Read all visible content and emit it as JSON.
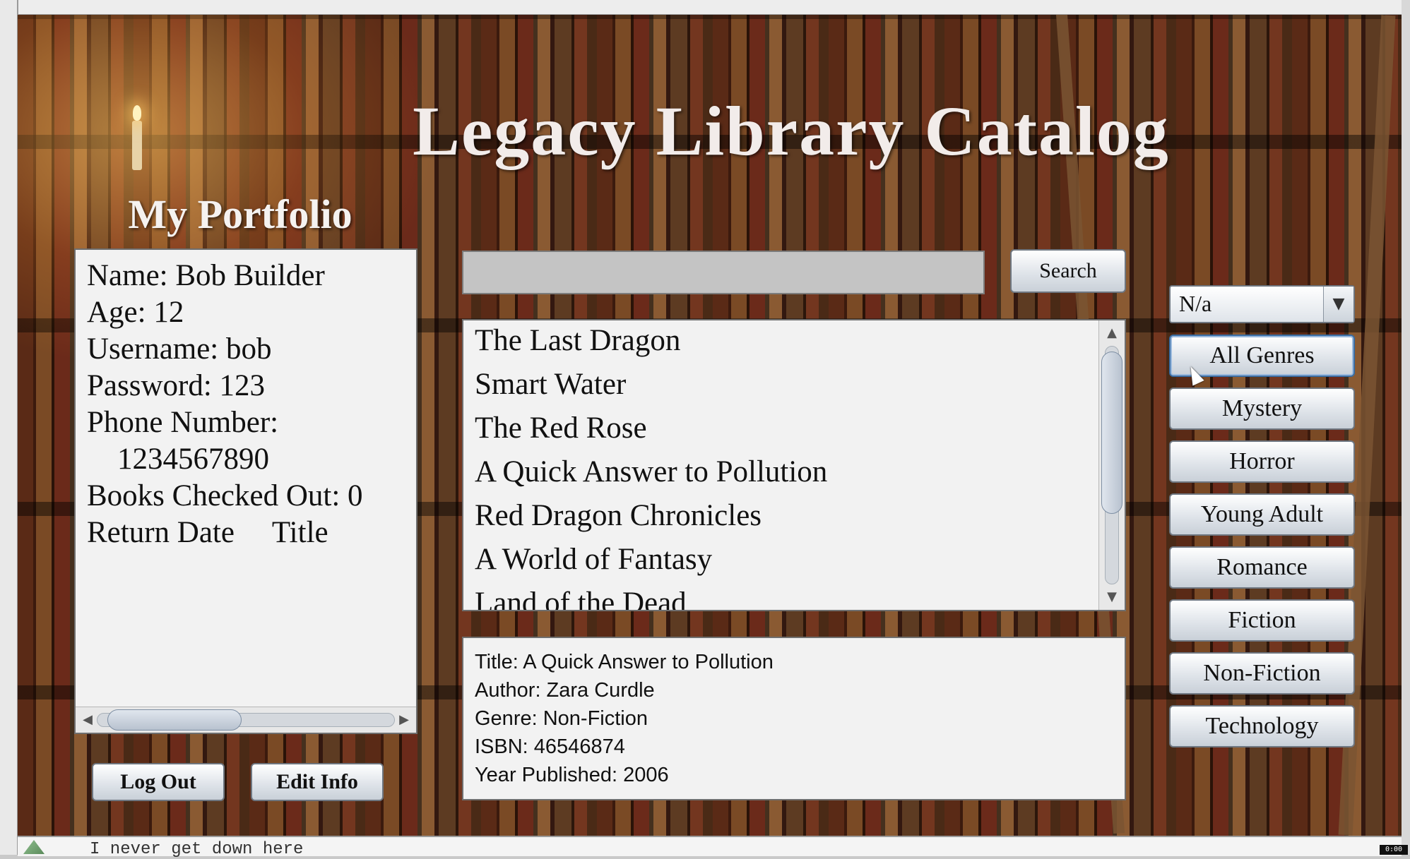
{
  "app": {
    "title": "Legacy Library Catalog"
  },
  "portfolio": {
    "heading": "My Portfolio",
    "lines": [
      "Name: Bob Builder",
      "Age: 12",
      "Username: bob",
      "Password: 123",
      "Phone Number:",
      "    1234567890",
      "Books Checked Out: 0",
      "Return Date     Title"
    ],
    "logout_label": "Log Out",
    "edit_info_label": "Edit Info"
  },
  "search": {
    "value": "",
    "button_label": "Search"
  },
  "book_list": {
    "items": [
      "The Last Dragon",
      "Smart Water",
      "The Red Rose",
      "A Quick Answer to Pollution",
      "Red Dragon Chronicles",
      "A World of Fantasy",
      "Land of the Dead"
    ]
  },
  "details": {
    "lines": [
      "Title: A Quick Answer to Pollution",
      "Author: Zara Curdle",
      "Genre: Non-Fiction",
      "ISBN: 46546874",
      "Year Published: 2006"
    ]
  },
  "genres": {
    "selected": "N/a",
    "buttons": [
      "All Genres",
      "Mystery",
      "Horror",
      "Young Adult",
      "Romance",
      "Fiction",
      "Non-Fiction",
      "Technology"
    ]
  },
  "status_bar": {
    "text": "I never get down here",
    "clock": "0:00"
  },
  "icons": {
    "scroll_up": "▲",
    "scroll_down": "▼",
    "scroll_left": "◀",
    "scroll_right": "▶",
    "dropdown": "▼"
  }
}
